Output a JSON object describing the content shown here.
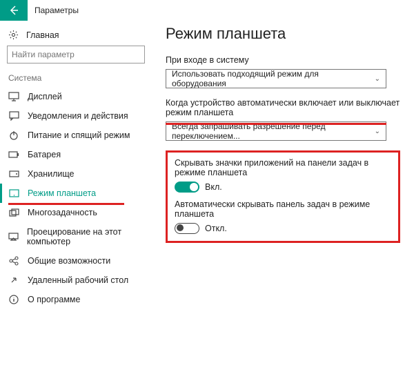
{
  "titlebar": {
    "app_title": "Параметры"
  },
  "sidebar": {
    "home": "Главная",
    "search_placeholder": "Найти параметр",
    "group": "Система",
    "items": [
      {
        "label": "Дисплей"
      },
      {
        "label": "Уведомления и действия"
      },
      {
        "label": "Питание и спящий режим"
      },
      {
        "label": "Батарея"
      },
      {
        "label": "Хранилище"
      },
      {
        "label": "Режим планшета"
      },
      {
        "label": "Многозадачность"
      },
      {
        "label": "Проецирование на этот компьютер"
      },
      {
        "label": "Общие возможности"
      },
      {
        "label": "Удаленный рабочий стол"
      },
      {
        "label": "О программе"
      }
    ]
  },
  "main": {
    "title": "Режим планшета",
    "signin": {
      "label": "При входе в систему",
      "value": "Использовать подходящий режим для оборудования"
    },
    "auto": {
      "label": "Когда устройство автоматически включает или выключает режим планшета",
      "value": "Всегда запрашивать разрешение перед переключением..."
    },
    "hide_icons": {
      "label": "Скрывать значки приложений на панели задач в режиме планшета",
      "state": "Вкл."
    },
    "hide_taskbar": {
      "label": "Автоматически скрывать панель задач в режиме планшета",
      "state": "Откл."
    }
  }
}
